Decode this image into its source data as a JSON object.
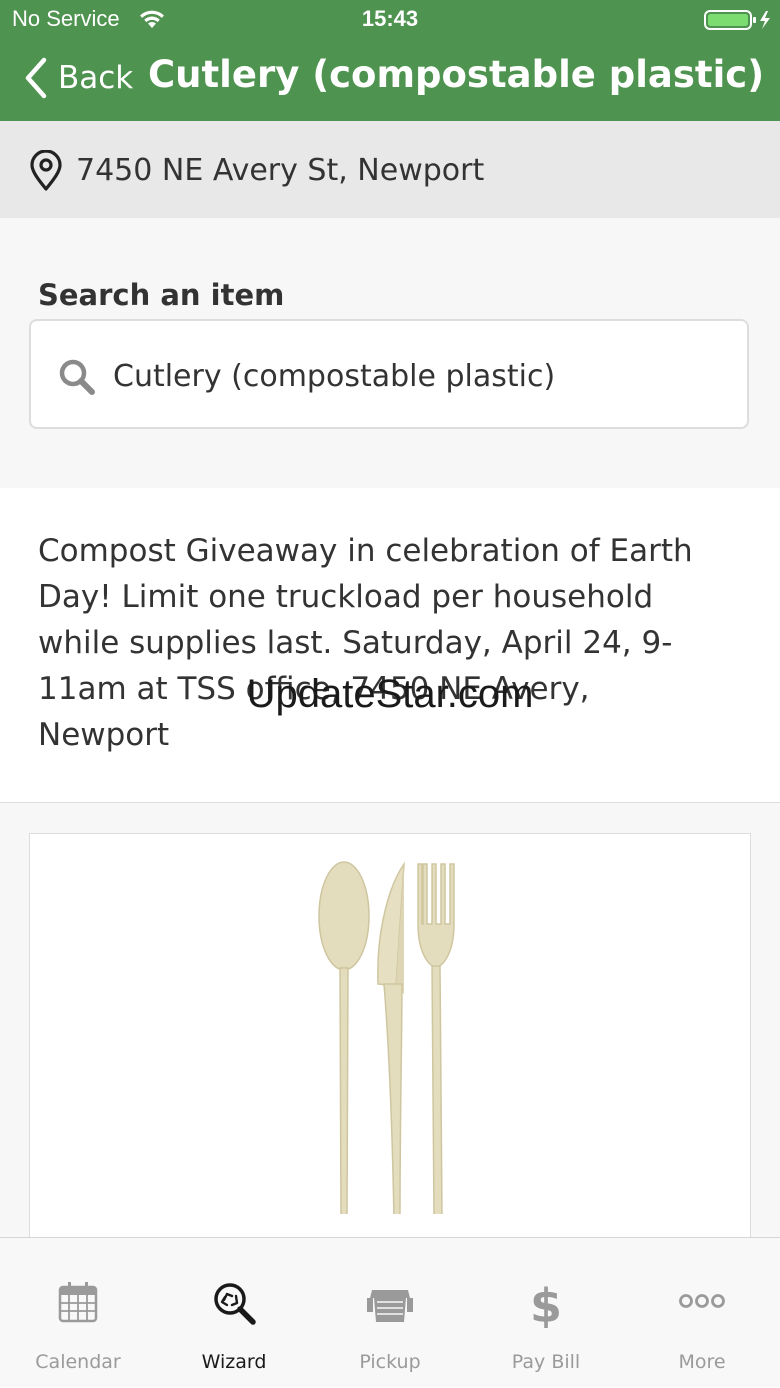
{
  "status_bar": {
    "carrier": "No Service",
    "time": "15:43"
  },
  "nav": {
    "back_label": "Back",
    "title": "Cutlery (compostable plastic)"
  },
  "address": {
    "text": "7450 NE Avery St, Newport"
  },
  "search": {
    "label": "Search an item",
    "value": "Cutlery (compostable plastic)"
  },
  "info": {
    "text": "Compost Giveaway in celebration of Earth Day! Limit one truckload per household while supplies last. Saturday, April 24, 9-11am at TSS office, 7450 NE Avery, Newport"
  },
  "watermark": "UpdateStar.com",
  "tabs": [
    {
      "label": "Calendar",
      "icon": "calendar-icon",
      "active": false
    },
    {
      "label": "Wizard",
      "icon": "wizard-search-icon",
      "active": true
    },
    {
      "label": "Pickup",
      "icon": "pickup-bin-icon",
      "active": false
    },
    {
      "label": "Pay Bill",
      "icon": "dollar-icon",
      "active": false
    },
    {
      "label": "More",
      "icon": "more-icon",
      "active": false
    }
  ],
  "colors": {
    "header": "#4f9350",
    "address_bar": "#e8e8e8",
    "tab_inactive": "#9a9a9a",
    "tab_active": "#1a1a1a"
  }
}
